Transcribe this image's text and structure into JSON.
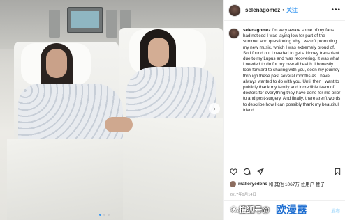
{
  "header": {
    "username": "selenagomez",
    "separator": "•",
    "follow_label": "关注",
    "more": "•••"
  },
  "caption": {
    "username": "selenagomez",
    "text": "I'm very aware some of my fans had noticed I was laying low for part of the summer and questioning why I wasn't promoting my new music, which I was extremely proud of. So I found out I needed to get a kidney transplant due to my Lupus and was recovering. It was what I needed to do for my overall health. I honestly look forward to sharing with you, soon my journey through these past several months as I have always wanted to do with you. Until then I want to publicly thank my family and incredible team of doctors for everything they have done for me prior to and post-surgery. And finally, there aren't words to describe how I can possibly thank my beautiful friend"
  },
  "likes": {
    "first_user": "malloryedens",
    "rest": "和 其他 1067万 位用户 赞了"
  },
  "date": "2017年9月14日",
  "comment": {
    "placeholder": "添加评论...",
    "post_label": "发布"
  },
  "photo": {
    "next_icon": "›"
  },
  "watermark": {
    "text": "搜狐号@",
    "brand": "欧漫露"
  },
  "colors": {
    "accent": "#3897f0",
    "text": "#262626",
    "muted": "#999999"
  },
  "icons": [
    "heart-icon",
    "comment-icon",
    "share-icon",
    "bookmark-icon",
    "more-icon",
    "chevron-right-icon"
  ]
}
